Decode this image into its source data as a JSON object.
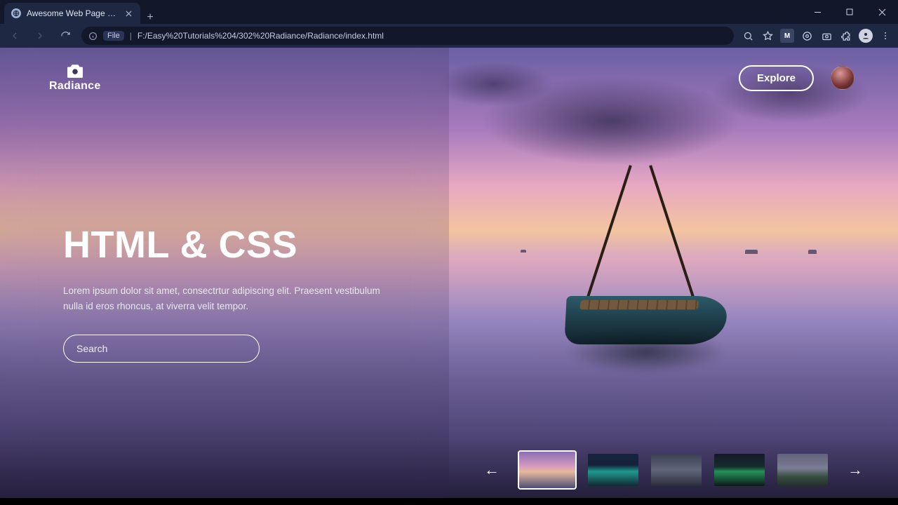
{
  "browser": {
    "tab_title": "Awesome Web Page Design - Ea",
    "url_scheme_label": "File",
    "url_path": "F:/Easy%20Tutorials%204/302%20Radiance/Radiance/index.html"
  },
  "brand": {
    "name": "Radiance",
    "icon": "camera-icon"
  },
  "header": {
    "explore_label": "Explore"
  },
  "hero": {
    "title": "HTML & CSS",
    "body": "Lorem ipsum dolor sit amet, consectrtur adipiscing elit. Praesent vestibulum nulla id eros rhoncus, at viverra velit tempor.",
    "search_placeholder": "Search"
  },
  "thumbnails": {
    "active_index": 0,
    "items": [
      {
        "name": "sunset-boat"
      },
      {
        "name": "aurora-teal"
      },
      {
        "name": "overcast-hills"
      },
      {
        "name": "aurora-green"
      },
      {
        "name": "mountain-valley"
      }
    ]
  },
  "colors": {
    "accent_border": "#ffffff",
    "sky_top": "#6b5fa3",
    "sky_warm": "#f3c49f",
    "water_deep": "#3f3b63"
  }
}
